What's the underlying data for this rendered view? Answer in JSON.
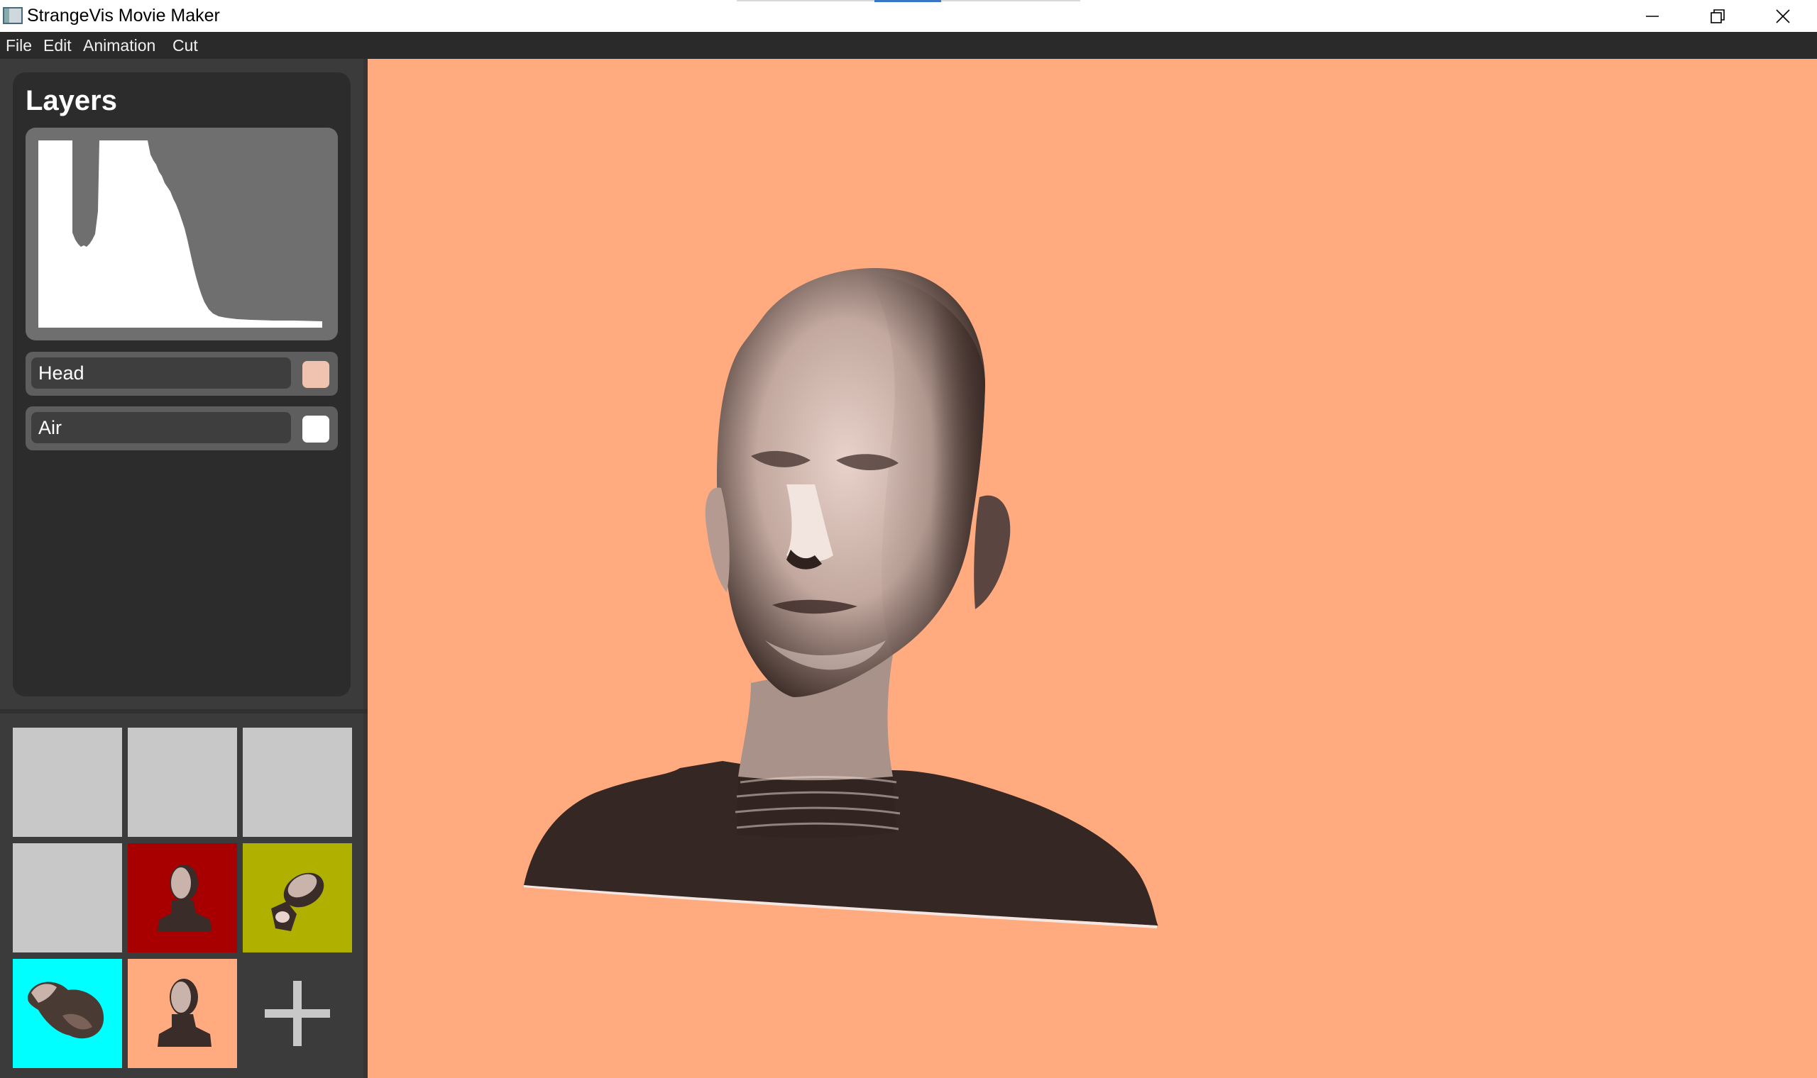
{
  "window": {
    "title": "StrangeVis Movie Maker",
    "controls": [
      "minimize",
      "restore",
      "close"
    ]
  },
  "menu": {
    "items": [
      "File",
      "Edit",
      "Animation",
      "Cut"
    ]
  },
  "layers_panel": {
    "title": "Layers",
    "layers": [
      {
        "name": "Head",
        "color": "#f0c2b0"
      },
      {
        "name": "Air",
        "color": "#ffffff"
      }
    ]
  },
  "presets": {
    "slots": [
      {
        "kind": "empty",
        "background": "#c8c8c8"
      },
      {
        "kind": "empty",
        "background": "#c8c8c8"
      },
      {
        "kind": "empty",
        "background": "#c8c8c8"
      },
      {
        "kind": "empty",
        "background": "#c8c8c8"
      },
      {
        "kind": "head-front",
        "background": "#a80000"
      },
      {
        "kind": "head-tilted",
        "background": "#b0b000"
      },
      {
        "kind": "head-side",
        "background": "#00ffff"
      },
      {
        "kind": "head-front",
        "background": "#ffaa7f"
      }
    ],
    "add_icon": "plus-icon"
  },
  "viewport": {
    "background": "#ffaa7f",
    "render": "head-volume-render"
  }
}
